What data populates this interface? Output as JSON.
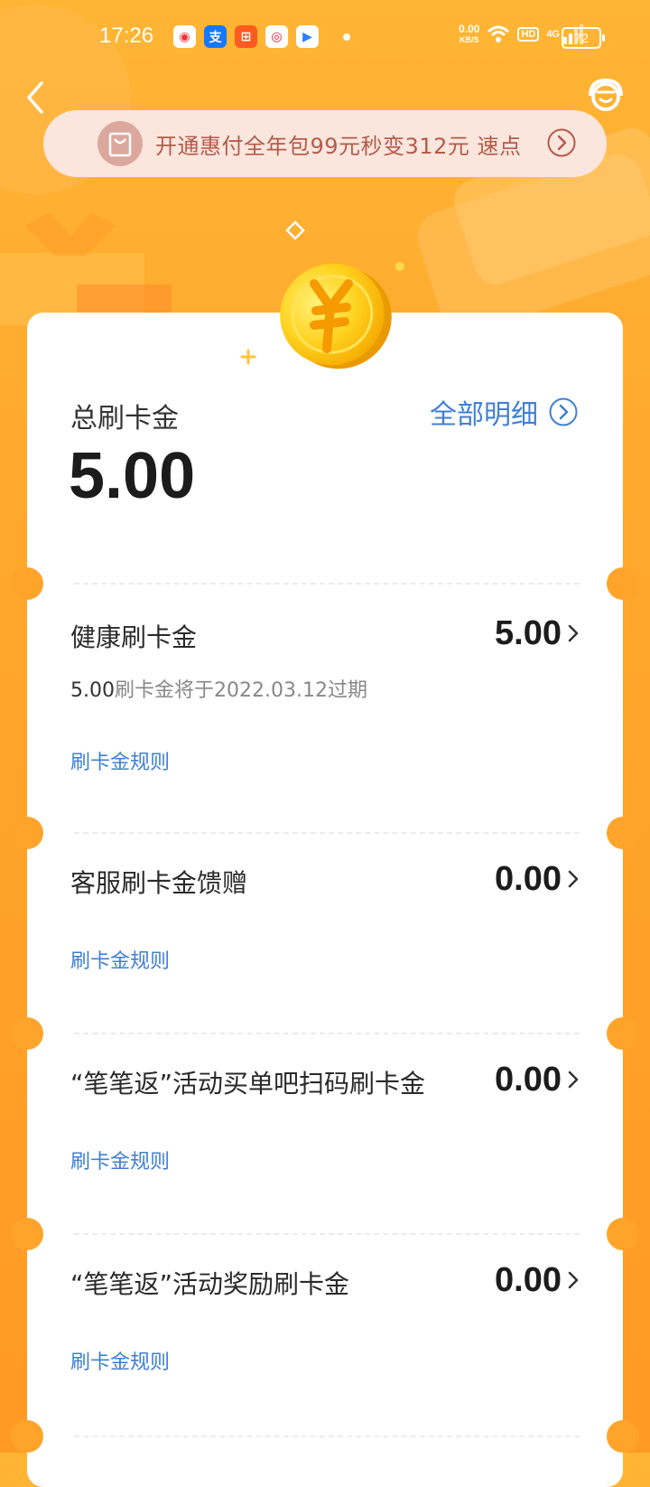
{
  "status_bar": {
    "time": "17:26",
    "app_icons": [
      "maps-app-icon",
      "alipay-app-icon",
      "kuaishou-app-icon",
      "weibo-app-icon",
      "youku-app-icon"
    ],
    "net_speed_value": "0.00",
    "net_speed_unit": "KB/S",
    "hd": "HD",
    "signal": "4G",
    "battery": "72"
  },
  "banner": {
    "text": "开通惠付全年包99元秒变312元  速点"
  },
  "summary": {
    "total_label": "总刷卡金",
    "detail_link": "全部明细",
    "total_amount": "5.00"
  },
  "items": [
    {
      "title": "健康刷卡金",
      "amount": "5.00",
      "expire_amount": "5.00",
      "expire_text": "刷卡金将于2022.03.12过期",
      "rule_link": "刷卡金规则"
    },
    {
      "title": "客服刷卡金馈赠",
      "amount": "0.00",
      "rule_link": "刷卡金规则"
    },
    {
      "title": "“笔笔返”活动买单吧扫码刷卡金",
      "amount": "0.00",
      "rule_link": "刷卡金规则"
    },
    {
      "title": "“笔笔返”活动奖励刷卡金",
      "amount": "0.00",
      "rule_link": "刷卡金规则"
    }
  ],
  "colors": {
    "background_orange": "#ffa329",
    "link_blue": "#3f7fd6",
    "banner_bg": "#fbe6dd",
    "banner_text": "#b55a4b",
    "coin_yellow": "#ffd21f"
  }
}
